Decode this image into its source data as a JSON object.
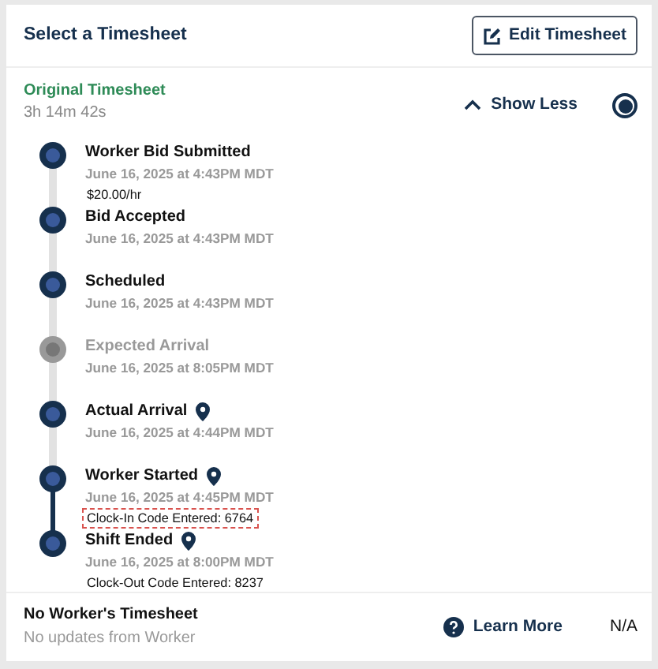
{
  "header": {
    "title": "Select a Timesheet",
    "edit_button": "Edit Timesheet"
  },
  "original": {
    "title": "Original Timesheet",
    "duration": "3h 14m 42s",
    "toggle": "Show Less",
    "expanded": true,
    "selected": true
  },
  "events": [
    {
      "title": "Worker Bid Submitted",
      "date": "June 16, 2025 at 4:43PM MDT",
      "note": "$20.00/hr",
      "completed": true,
      "location": false,
      "connected": false,
      "highlighted": false
    },
    {
      "title": "Bid Accepted",
      "date": "June 16, 2025 at 4:43PM MDT",
      "completed": true,
      "location": false,
      "connected": false
    },
    {
      "title": "Scheduled",
      "date": "June 16, 2025 at 4:43PM MDT",
      "completed": true,
      "location": false,
      "connected": false
    },
    {
      "title": "Expected Arrival",
      "date": "June 16, 2025 at 8:05PM MDT",
      "completed": false,
      "location": false,
      "connected": false
    },
    {
      "title": "Actual Arrival",
      "date": "June 16, 2025 at 4:44PM MDT",
      "completed": true,
      "location": true,
      "connected": false
    },
    {
      "title": "Worker Started",
      "date": "June 16, 2025 at 4:45PM MDT",
      "note": "Clock-In Code Entered: 6764",
      "completed": true,
      "location": true,
      "connected": true,
      "highlighted": true
    },
    {
      "title": "Shift Ended",
      "date": "June 16, 2025 at 8:00PM MDT",
      "note": "Clock-Out Code Entered: 8237",
      "completed": true,
      "location": true,
      "highlighted": false
    }
  ],
  "worker": {
    "title": "No Worker's Timesheet",
    "subtitle": "No updates from Worker",
    "link": "Learn More",
    "value": "N/A"
  }
}
